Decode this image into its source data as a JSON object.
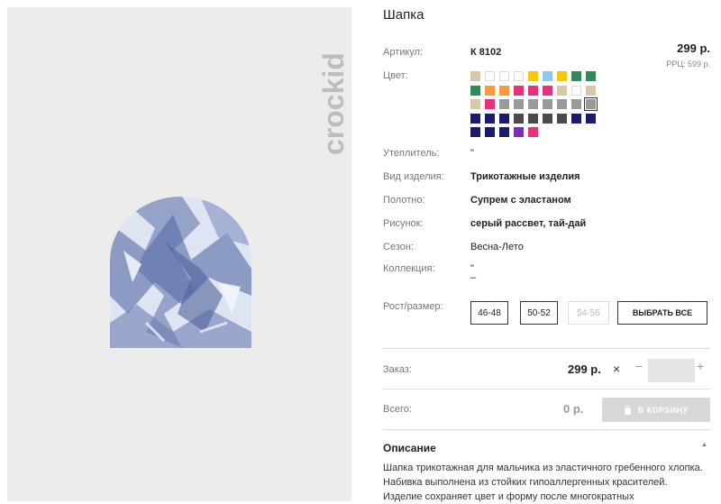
{
  "brand": {
    "logo_text": "crockid"
  },
  "product": {
    "title": "Шапка",
    "article_label": "Артикул:",
    "article_value": "К 8102",
    "price": "299 р.",
    "rrp": "РРЦ: 599 р.",
    "color_label": "Цвет:",
    "insulation_label": "Утеплитель:",
    "insulation_value": "\"",
    "type_label": "Вид изделия:",
    "type_value": "Трикотажные изделия",
    "fabric_label": "Полотно:",
    "fabric_value": "Супрем с эластаном",
    "pattern_label": "Рисунок:",
    "pattern_value": "серый рассвет, тай-дай",
    "season_label": "Сезон:",
    "season_value": "Весна-Лето",
    "collection_label": "Коллекция:",
    "collection_value": "\"",
    "collection_value2": "–",
    "size_label": "Рост/размер:",
    "sizes": [
      {
        "label": "46-48",
        "enabled": true
      },
      {
        "label": "50-52",
        "enabled": true
      },
      {
        "label": "54-56",
        "enabled": false
      }
    ],
    "select_all": "ВЫБРАТЬ ВСЕ"
  },
  "order": {
    "order_label": "Заказ:",
    "unit_price": "299 р.",
    "times": "×",
    "minus": "−",
    "plus": "+",
    "qty_value": "",
    "total_label": "Всего:",
    "total_value": "0 р.",
    "cart_button": "В КОРЗИНУ"
  },
  "description": {
    "title": "Описание",
    "toggle": "▲",
    "text": "Шапка трикотажная для мальчика из эластичного гребенного хлопка. Набивка выполнена из стойких гипоаллергенных красителей. Изделие сохраняет цвет и форму после многократных"
  },
  "swatch_colors": [
    [
      "#d9c8a8",
      "#ffffff",
      "#ffffff",
      "#ffffff",
      "#f6c900",
      "#8ec9f0",
      "#f6c900",
      "#2e8b57",
      "#2e8b57"
    ],
    [
      "#2e8b57",
      "#ff9a3c",
      "#ff9a3c",
      "#e8317a",
      "#e8317a",
      "#e8317a",
      "#d9c8a8",
      "#ffffff",
      "#d9c8a8"
    ],
    [
      "#d9c8a8",
      "#e8317a",
      "#9a9a9a",
      "#9a9a9a",
      "#9a9a9a",
      "#9a9a9a",
      "#9a9a9a",
      "#9a9a9a",
      "#9a9a9a"
    ],
    [
      "#1c1a6b",
      "#1c1a6b",
      "#1c1a6b",
      "#4a4a4a",
      "#4a4a4a",
      "#4a4a4a",
      "#4a4a4a",
      "#1c1a6b",
      "#1c1a6b"
    ],
    [
      "#1c1a6b",
      "#1c1a6b",
      "#1c1a6b",
      "#7a2fb0",
      "#e8317a"
    ]
  ]
}
